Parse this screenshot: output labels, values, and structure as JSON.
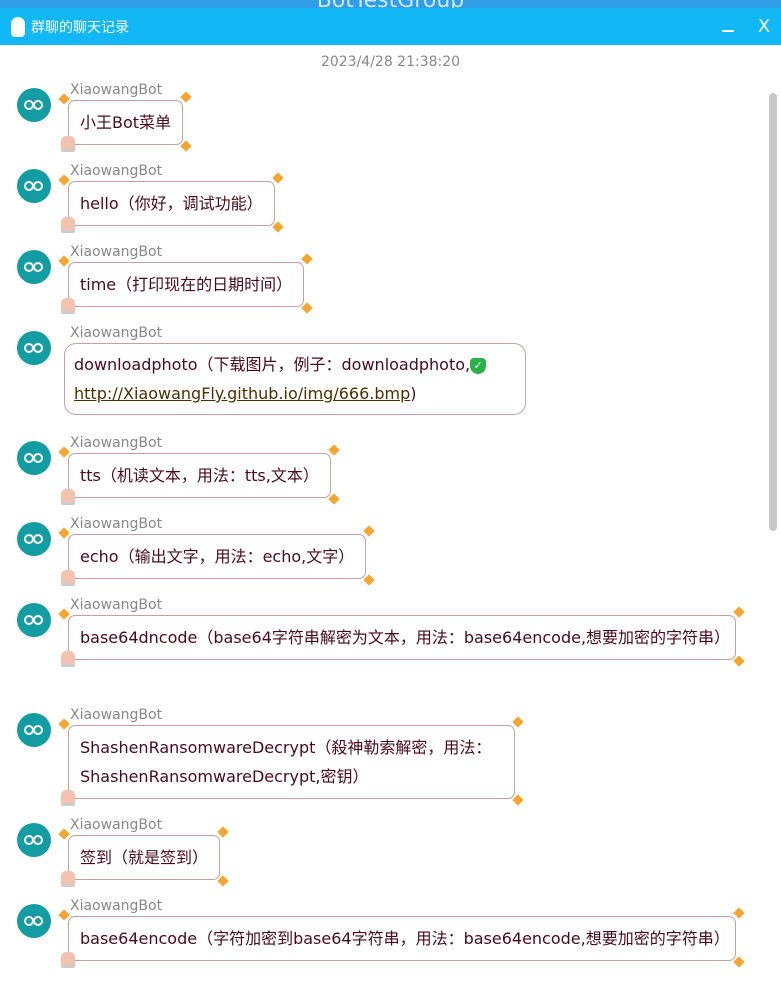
{
  "background_window_title": "BotTestGroup",
  "window": {
    "title": "群聊的聊天记录",
    "minimize": "_",
    "close": "X"
  },
  "timestamp": "2023/4/28 21:38:20",
  "messages": [
    {
      "sender": "XiaowangBot",
      "text": "小王Bot菜单"
    },
    {
      "sender": "XiaowangBot",
      "text": "hello（你好，调试功能）"
    },
    {
      "sender": "XiaowangBot",
      "text": "time（打印现在的日期时间）"
    },
    {
      "sender": "XiaowangBot",
      "text": "downloadphoto（下载图片，例子：downloadphoto,",
      "link": "http://XiaowangFly.github.io/img/666.bmp",
      "suffix": ")"
    },
    {
      "sender": "XiaowangBot",
      "text": "tts（机读文本，用法：tts,文本）"
    },
    {
      "sender": "XiaowangBot",
      "text": "echo（输出文字，用法：echo,文字）"
    },
    {
      "sender": "XiaowangBot",
      "text": "base64dncode（base64字符串解密为文本，用法：base64encode,想要加密的字符串）"
    },
    {
      "sender": "XiaowangBot",
      "text": "ShashenRansomwareDecrypt（殺神勒索解密，用法：ShashenRansomwareDecrypt,密钥）"
    },
    {
      "sender": "XiaowangBot",
      "text": "签到（就是签到）"
    },
    {
      "sender": "XiaowangBot",
      "text": "base64encode（字符加密到base64字符串，用法：base64encode,想要加密的字符串）"
    }
  ]
}
